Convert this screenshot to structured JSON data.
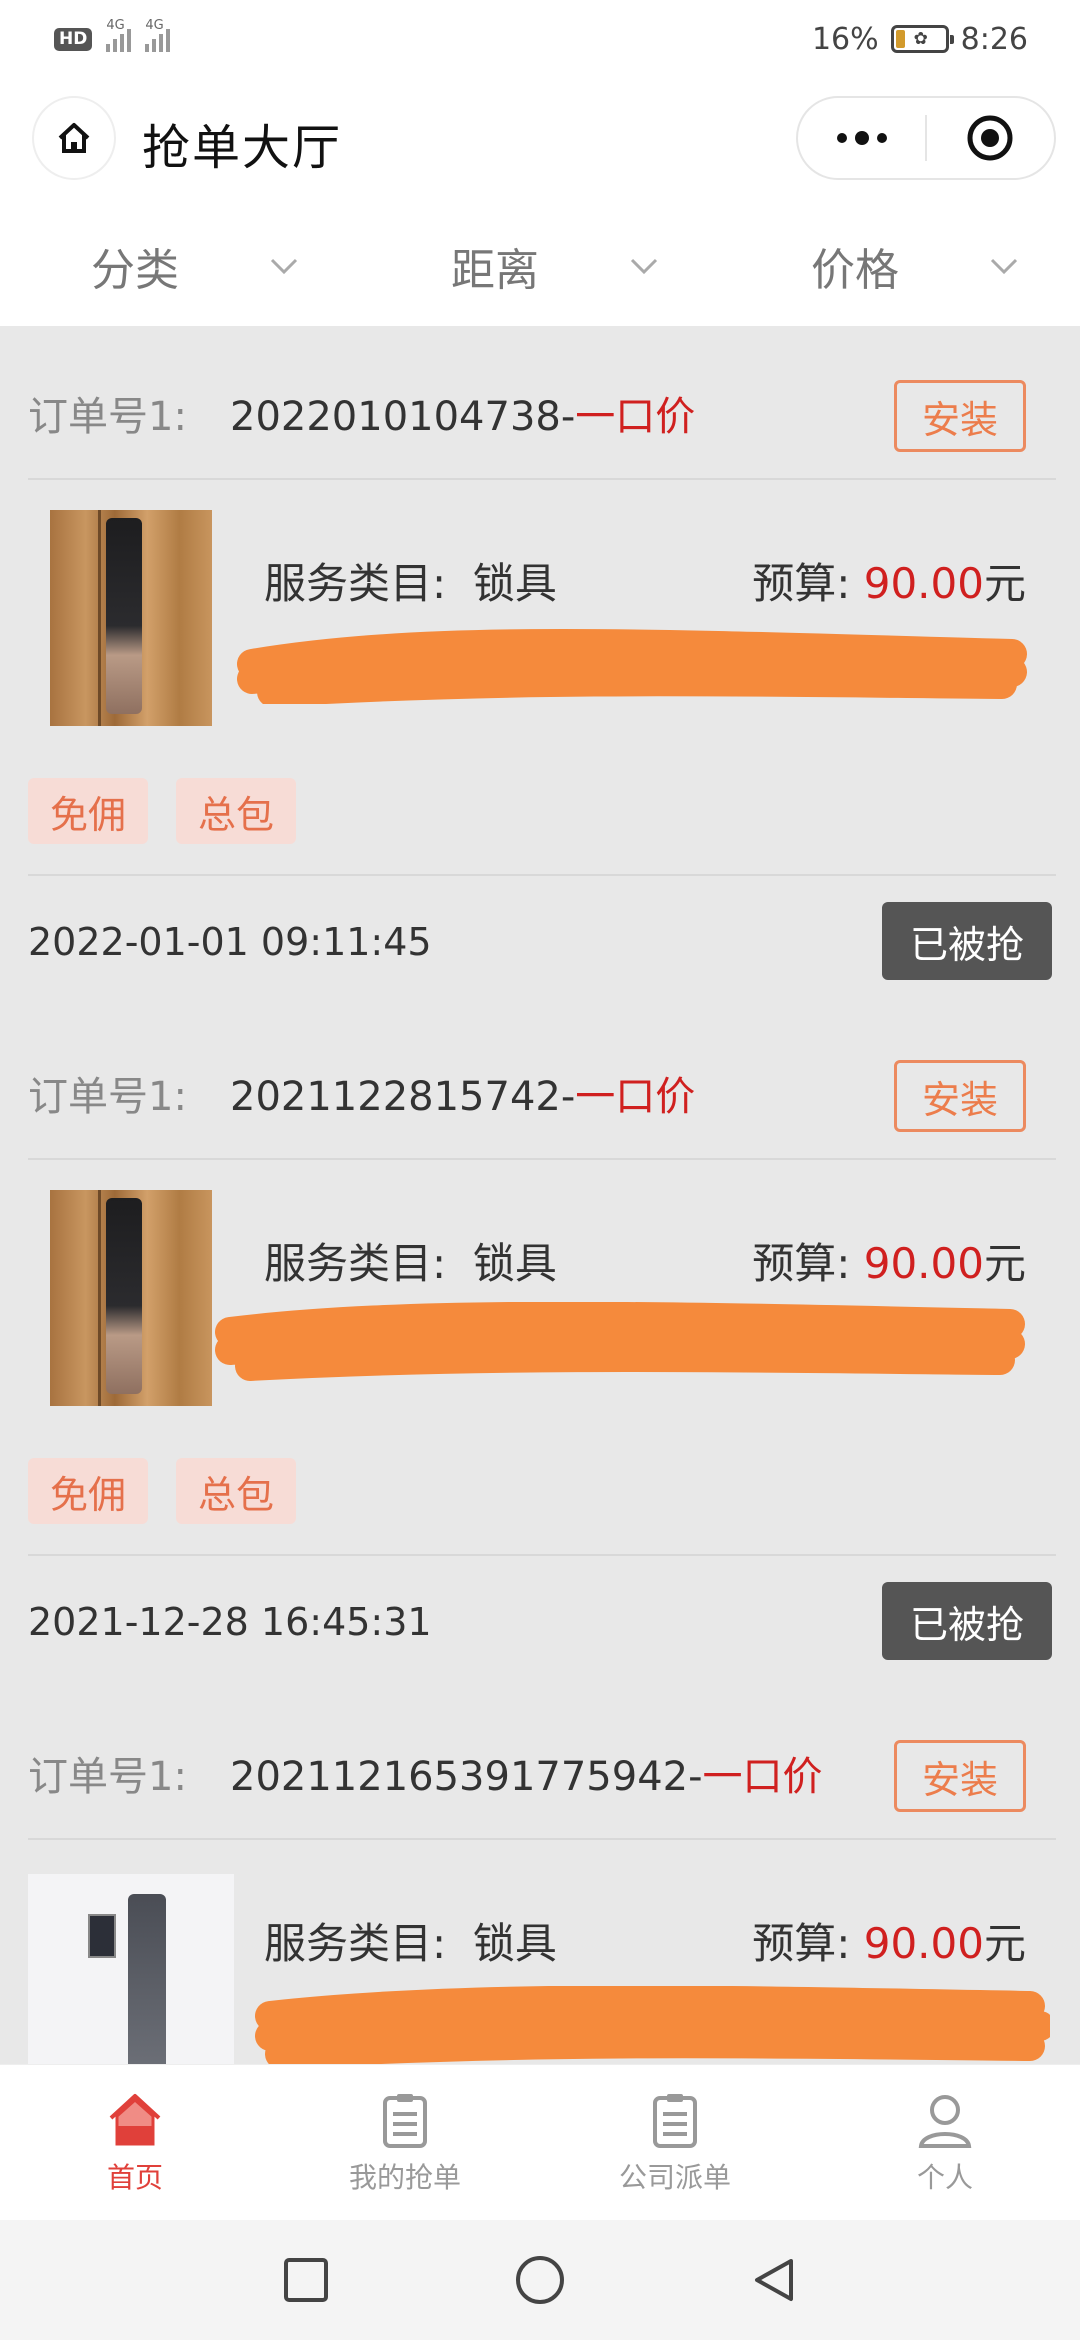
{
  "status_bar": {
    "hd": "HD",
    "net1": "4G",
    "net2": "4G",
    "battery": "16%",
    "time": "8:26"
  },
  "header": {
    "title": "抢单大厅"
  },
  "filters": [
    {
      "label": "分类"
    },
    {
      "label": "距离"
    },
    {
      "label": "价格"
    }
  ],
  "orders": [
    {
      "order_label": "订单号1:",
      "order_no": "2022010104738",
      "sep": "-",
      "price_type": "一口价",
      "action": "安装",
      "service_label": "服务类目:",
      "service": "锁具",
      "budget_label": "预算:",
      "budget_amount": "90.00",
      "budget_unit": "元",
      "tags": [
        "免佣",
        "总包"
      ],
      "time": "2022-01-01 09:11:45",
      "status": "已被抢"
    },
    {
      "order_label": "订单号1:",
      "order_no": "2021122815742",
      "sep": "-",
      "price_type": "一口价",
      "action": "安装",
      "service_label": "服务类目:",
      "service": "锁具",
      "budget_label": "预算:",
      "budget_amount": "90.00",
      "budget_unit": "元",
      "tags": [
        "免佣",
        "总包"
      ],
      "time": "2021-12-28 16:45:31",
      "status": "已被抢"
    },
    {
      "order_label": "订单号1:",
      "order_no": "202112165391775942",
      "sep": "-",
      "price_type": "一口价",
      "action": "安装",
      "service_label": "服务类目:",
      "service": "锁具",
      "budget_label": "预算:",
      "budget_amount": "90.00",
      "budget_unit": "元"
    }
  ],
  "tabs": [
    {
      "label": "首页",
      "icon": "home-icon",
      "active": true
    },
    {
      "label": "我的抢单",
      "icon": "clipboard-icon",
      "active": false
    },
    {
      "label": "公司派单",
      "icon": "clipboard-icon",
      "active": false
    },
    {
      "label": "个人",
      "icon": "person-icon",
      "active": false
    }
  ],
  "colors": {
    "accent_red": "#d0201f",
    "install_orange": "#ec7d4c",
    "tag_bg": "#f7dcd6",
    "tab_active": "#e0403a",
    "redaction": "#f58a3c"
  }
}
